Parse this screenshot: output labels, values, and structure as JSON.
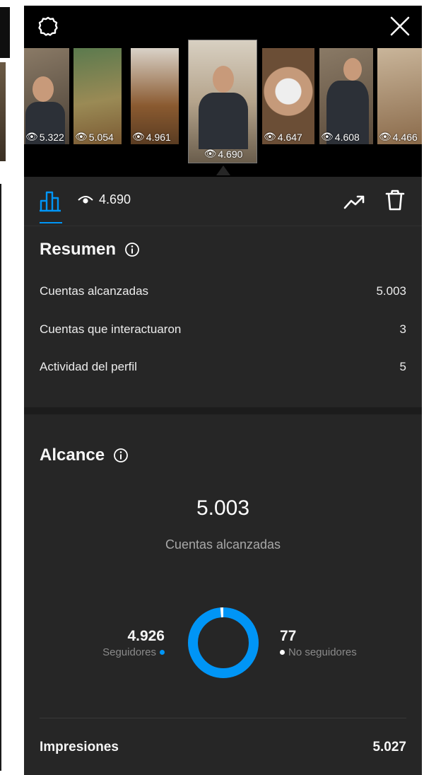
{
  "thumbnails": [
    {
      "views": "5.322"
    },
    {
      "views": "5.054"
    },
    {
      "views": "4.961"
    },
    {
      "views": "4.690",
      "selected": true
    },
    {
      "views": "4.647"
    },
    {
      "views": "4.608"
    },
    {
      "views": "4.466"
    }
  ],
  "tabbar": {
    "views_total": "4.690",
    "icons": [
      "bar-chart-icon",
      "eye-icon",
      "trending-up-icon",
      "trash-icon"
    ]
  },
  "summary": {
    "title": "Resumen",
    "rows": [
      {
        "label": "Cuentas alcanzadas",
        "value": "5.003"
      },
      {
        "label": "Cuentas que interactuaron",
        "value": "3"
      },
      {
        "label": "Actividad del perfil",
        "value": "5"
      }
    ]
  },
  "reach": {
    "title": "Alcance",
    "accounts_reached": "5.003",
    "accounts_reached_label": "Cuentas alcanzadas",
    "followers": {
      "value": "4.926",
      "label": "Seguidores"
    },
    "non_followers": {
      "value": "77",
      "label": "No seguidores"
    },
    "impressions_label": "Impresiones",
    "impressions_value": "5.027"
  },
  "colors": {
    "accent": "#0095f6",
    "background": "#262626",
    "header": "#000000",
    "secondary_text": "#a8a8a8"
  }
}
